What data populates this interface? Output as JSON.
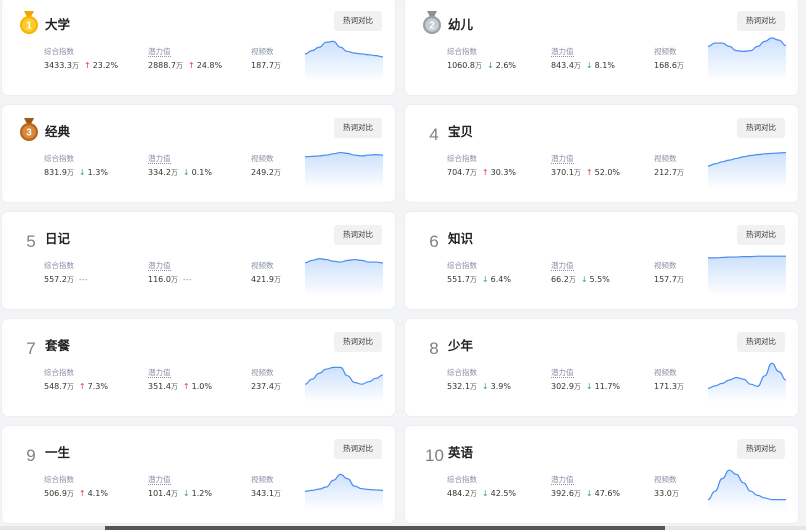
{
  "compare_label": "热词对比",
  "labels": {
    "composite": "综合指数",
    "potential": "潜力值",
    "videos": "视频数"
  },
  "unit": "万",
  "flat_mark": "---",
  "colors": {
    "up": "#e23b3b",
    "down": "#34a853",
    "line": "#4a8cef"
  },
  "cards": [
    {
      "rank": "1",
      "medal": "gold",
      "keyword": "大学",
      "composite": "3433.3",
      "composite_dir": "up",
      "composite_pct": "23.2%",
      "potential": "2888.7",
      "potential_dir": "up",
      "potential_pct": "24.8%",
      "videos": "187.7",
      "trend": [
        0.62,
        0.7,
        0.78,
        0.9,
        0.92,
        0.78,
        0.68,
        0.64,
        0.62,
        0.6,
        0.58,
        0.55
      ]
    },
    {
      "rank": "2",
      "medal": "silver",
      "keyword": "幼儿",
      "composite": "1060.8",
      "composite_dir": "down",
      "composite_pct": "2.6%",
      "potential": "843.4",
      "potential_dir": "down",
      "potential_pct": "8.1%",
      "videos": "168.6",
      "trend": [
        0.8,
        0.88,
        0.88,
        0.8,
        0.7,
        0.68,
        0.7,
        0.8,
        0.92,
        1.0,
        0.95,
        0.82
      ]
    },
    {
      "rank": "3",
      "medal": "bronze",
      "keyword": "经典",
      "composite": "831.9",
      "composite_dir": "down",
      "composite_pct": "1.3%",
      "potential": "334.2",
      "potential_dir": "down",
      "potential_pct": "0.1%",
      "videos": "249.2",
      "trend": [
        0.72,
        0.73,
        0.74,
        0.76,
        0.79,
        0.82,
        0.8,
        0.76,
        0.74,
        0.76,
        0.77,
        0.76
      ]
    },
    {
      "rank": "4",
      "medal": "",
      "keyword": "宝贝",
      "composite": "704.7",
      "composite_dir": "up",
      "composite_pct": "30.3%",
      "potential": "370.1",
      "potential_dir": "up",
      "potential_pct": "52.0%",
      "videos": "212.7",
      "trend": [
        0.5,
        0.55,
        0.6,
        0.64,
        0.68,
        0.72,
        0.75,
        0.77,
        0.79,
        0.8,
        0.81,
        0.82
      ]
    },
    {
      "rank": "5",
      "medal": "",
      "keyword": "日记",
      "composite": "557.2",
      "composite_dir": "flat",
      "composite_pct": "",
      "potential": "116.0",
      "potential_dir": "flat",
      "potential_pct": "",
      "videos": "421.9",
      "trend": [
        0.74,
        0.8,
        0.84,
        0.82,
        0.78,
        0.76,
        0.8,
        0.82,
        0.8,
        0.76,
        0.76,
        0.74
      ]
    },
    {
      "rank": "6",
      "medal": "",
      "keyword": "知识",
      "composite": "551.7",
      "composite_dir": "down",
      "composite_pct": "6.4%",
      "potential": "66.2",
      "potential_dir": "down",
      "potential_pct": "5.5%",
      "videos": "157.7",
      "trend": [
        0.86,
        0.86,
        0.87,
        0.88,
        0.88,
        0.89,
        0.89,
        0.9,
        0.9,
        0.9,
        0.9,
        0.9
      ]
    },
    {
      "rank": "7",
      "medal": "",
      "keyword": "套餐",
      "composite": "548.7",
      "composite_dir": "up",
      "composite_pct": "7.3%",
      "potential": "351.4",
      "potential_dir": "up",
      "potential_pct": "1.0%",
      "videos": "237.4",
      "trend": [
        0.4,
        0.52,
        0.66,
        0.76,
        0.8,
        0.8,
        0.6,
        0.44,
        0.4,
        0.46,
        0.54,
        0.62
      ]
    },
    {
      "rank": "8",
      "medal": "",
      "keyword": "少年",
      "composite": "532.1",
      "composite_dir": "down",
      "composite_pct": "3.9%",
      "potential": "302.9",
      "potential_dir": "down",
      "potential_pct": "11.7%",
      "videos": "171.3",
      "trend": [
        0.3,
        0.36,
        0.42,
        0.5,
        0.56,
        0.52,
        0.4,
        0.35,
        0.6,
        0.9,
        0.7,
        0.5
      ]
    },
    {
      "rank": "9",
      "medal": "",
      "keyword": "一生",
      "composite": "506.9",
      "composite_dir": "up",
      "composite_pct": "4.1%",
      "potential": "101.4",
      "potential_dir": "down",
      "potential_pct": "1.2%",
      "videos": "343.1",
      "trend": [
        0.4,
        0.42,
        0.45,
        0.5,
        0.66,
        0.8,
        0.7,
        0.52,
        0.46,
        0.44,
        0.43,
        0.42
      ]
    },
    {
      "rank": "10",
      "medal": "",
      "keyword": "英语",
      "composite": "484.2",
      "composite_dir": "down",
      "composite_pct": "42.5%",
      "potential": "392.6",
      "potential_dir": "down",
      "potential_pct": "47.6%",
      "videos": "33.0",
      "trend": [
        0.2,
        0.4,
        0.7,
        0.9,
        0.8,
        0.6,
        0.4,
        0.3,
        0.24,
        0.2,
        0.2,
        0.2
      ]
    }
  ]
}
